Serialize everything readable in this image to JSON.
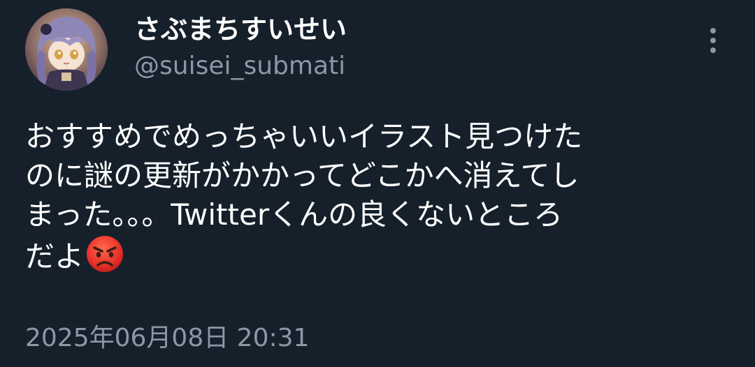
{
  "author": {
    "display_name": "さぶまちすいせい",
    "handle": "@suisei_submati",
    "avatar_icon": "avatar-anime-character"
  },
  "more_icon": "more-vertical-icon",
  "tweet": {
    "lines": [
      "おすすめでめっちゃいいイラスト見つけた",
      "のに謎の更新がかかってどこかへ消えてし",
      "まった。。。Twitterくんの良くないところ",
      "だよ"
    ],
    "emoji": "angry-face-emoji"
  },
  "timestamp": "2025年06月08日 20:31",
  "colors": {
    "background": "#15202b",
    "text_primary": "#ffffff",
    "text_secondary": "#8b98a5"
  }
}
